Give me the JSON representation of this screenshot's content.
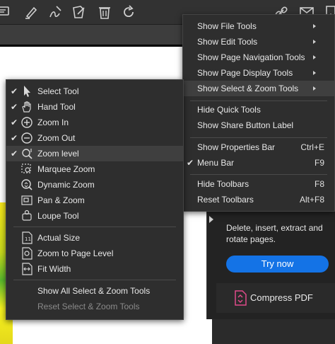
{
  "toolbar": {
    "icons": [
      "comment-icon",
      "highlight-icon",
      "draw-icon",
      "edit-icon",
      "delete-icon",
      "redo-icon",
      "link-icon",
      "mail-icon",
      "bookmark-icon"
    ]
  },
  "main_menu": {
    "items": [
      {
        "label": "Show File Tools",
        "submenu": true
      },
      {
        "label": "Show Edit Tools",
        "submenu": true
      },
      {
        "label": "Show Page Navigation Tools",
        "submenu": true
      },
      {
        "label": "Show Page Display Tools",
        "submenu": true
      },
      {
        "label": "Show Select & Zoom Tools",
        "submenu": true,
        "highlighted": true
      },
      {
        "label": "Hide Quick Tools"
      },
      {
        "label": "Show Share Button Label"
      },
      {
        "label": "Show Properties Bar",
        "shortcut": "Ctrl+E"
      },
      {
        "label": "Menu Bar",
        "shortcut": "F9",
        "checked": true
      },
      {
        "label": "Hide Toolbars",
        "shortcut": "F8"
      },
      {
        "label": "Reset Toolbars",
        "shortcut": "Alt+F8"
      }
    ]
  },
  "sub_menu": {
    "items": [
      {
        "label": "Select Tool",
        "checked": true,
        "icon": "select-arrow-icon"
      },
      {
        "label": "Hand Tool",
        "checked": true,
        "icon": "hand-icon"
      },
      {
        "label": "Zoom In",
        "checked": true,
        "icon": "zoom-in-icon"
      },
      {
        "label": "Zoom Out",
        "checked": true,
        "icon": "zoom-out-icon"
      },
      {
        "label": "Zoom level",
        "checked": true,
        "icon": "zoom-level-icon",
        "highlighted": true
      },
      {
        "label": "Marquee Zoom",
        "icon": "marquee-zoom-icon"
      },
      {
        "label": "Dynamic Zoom",
        "icon": "dynamic-zoom-icon"
      },
      {
        "label": "Pan & Zoom",
        "icon": "pan-zoom-icon"
      },
      {
        "label": "Loupe Tool",
        "icon": "loupe-icon"
      },
      {
        "label": "Actual Size",
        "icon": "actual-size-icon"
      },
      {
        "label": "Zoom to Page Level",
        "icon": "zoom-page-icon"
      },
      {
        "label": "Fit Width",
        "icon": "fit-width-icon"
      },
      {
        "label": "Show All Select & Zoom Tools"
      },
      {
        "label": "Reset Select & Zoom Tools",
        "disabled": true
      }
    ]
  },
  "right_panel": {
    "description": "Delete, insert, extract and rotate pages.",
    "button_label": "Try now",
    "tool_label": "Compress PDF"
  },
  "colors": {
    "accent": "#1473e6",
    "background": "#2b2b2b",
    "menu_bg": "#2e2e2e",
    "highlight": "#3f3f3f"
  }
}
